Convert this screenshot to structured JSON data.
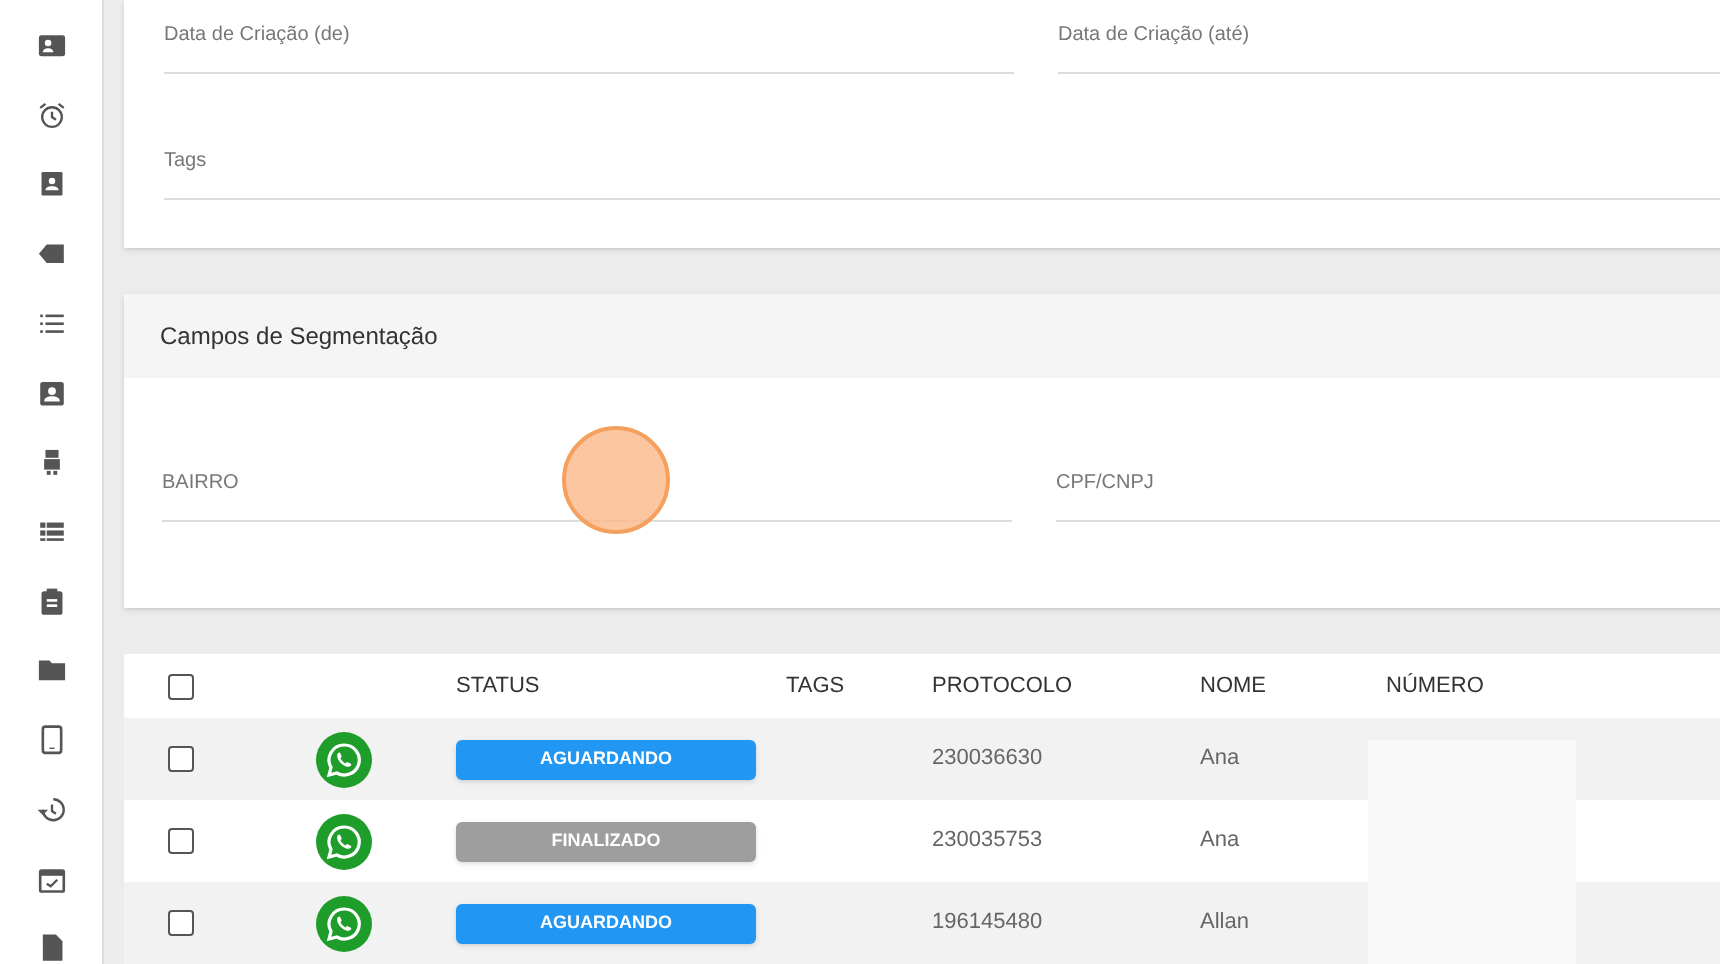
{
  "filters": {
    "fields": [
      {
        "label": "Data de Criação (de)"
      },
      {
        "label": "Data de Criação (até)"
      }
    ],
    "tags_field": {
      "label": "Tags"
    }
  },
  "segmentation": {
    "title": "Campos de Segmentação",
    "fields": [
      {
        "label": "BAIRRO"
      },
      {
        "label": "CPF/CNPJ"
      }
    ]
  },
  "table": {
    "select_all": {
      "checked": false
    },
    "columns": [
      "STATUS",
      "TAGS",
      "PROTOCOLO",
      "NOME",
      "NÚMERO"
    ],
    "rows": [
      {
        "checked": false,
        "status": {
          "label": "AGUARDANDO",
          "color": "#2196f3"
        },
        "protocolo": "230036630",
        "nome": "Ana"
      },
      {
        "checked": false,
        "status": {
          "label": "FINALIZADO",
          "color": "#9e9e9e"
        },
        "protocolo": "230035753",
        "nome": "Ana"
      },
      {
        "checked": false,
        "status": {
          "label": "AGUARDANDO",
          "color": "#2196f3"
        },
        "protocolo": "196145480",
        "nome": "Allan"
      }
    ]
  }
}
